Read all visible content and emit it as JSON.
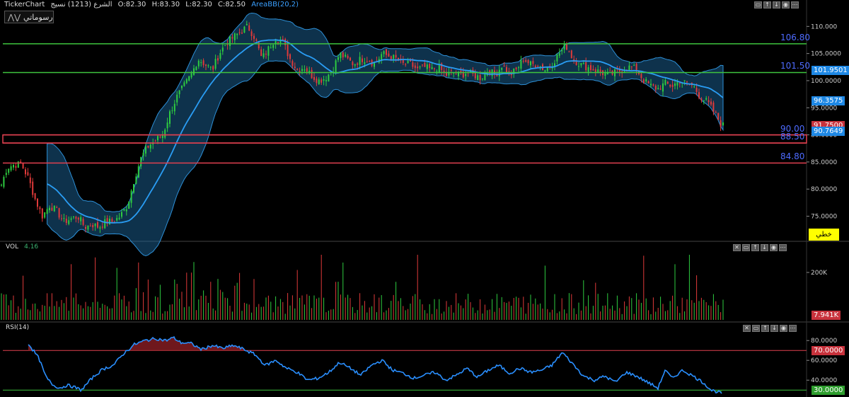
{
  "header": {
    "app": "TickerChart",
    "symbol": "الشرع (1213) نسيج",
    "open": "O:82.30",
    "high": "H:83.30",
    "low": "L:82.30",
    "close": "C:82.50",
    "indicator": "AreaBB(20,2)"
  },
  "toolbar": {
    "drawings_label": "رسوماتي"
  },
  "chart_type_label": "خطي",
  "colors": {
    "up": "#2ecc40",
    "down": "#e03a3a",
    "band": "#1e6ea8",
    "mid": "#2a9df4",
    "green_line": "#3ec43e",
    "red_line": "#e0404f",
    "level_text": "#4d6bff"
  },
  "chart_data": [
    {
      "type": "candlestick",
      "name": "price",
      "yticks": [
        "110.000",
        "105.0000",
        "100.0000",
        "95.0000",
        "80.0000",
        "85.0000",
        "80.0000",
        "75.0000"
      ],
      "ylim": [
        70.5,
        112.0
      ],
      "levels_green": [
        106.8,
        101.5
      ],
      "levels_red": [
        90.0,
        88.5,
        84.8
      ],
      "level_labels": [
        "106.80",
        "101.50",
        "90.00",
        "88.50",
        "84.80"
      ],
      "tags": [
        {
          "text": "101.9501",
          "value": 101.9501,
          "color": "#1e88e5"
        },
        {
          "text": "96.3575",
          "value": 96.3575,
          "color": "#1e88e5"
        },
        {
          "text": "91.7500",
          "value": 91.75,
          "color": "#c8323c"
        },
        {
          "text": "90.7649",
          "value": 90.7649,
          "color": "#1e88e5"
        }
      ],
      "keypoints": [
        [
          0,
          80
        ],
        [
          10,
          84
        ],
        [
          20,
          84.5
        ],
        [
          30,
          84.6
        ],
        [
          40,
          82
        ],
        [
          50,
          78
        ],
        [
          60,
          75
        ],
        [
          70,
          77
        ],
        [
          80,
          76
        ],
        [
          90,
          74
        ],
        [
          100,
          74.5
        ],
        [
          110,
          75
        ],
        [
          120,
          73
        ],
        [
          130,
          73.5
        ],
        [
          140,
          73
        ],
        [
          150,
          74
        ],
        [
          160,
          74
        ],
        [
          170,
          75
        ],
        [
          180,
          77
        ],
        [
          190,
          82
        ],
        [
          200,
          86
        ],
        [
          210,
          88
        ],
        [
          220,
          89
        ],
        [
          230,
          90
        ],
        [
          240,
          94
        ],
        [
          250,
          97
        ],
        [
          260,
          99
        ],
        [
          270,
          101
        ],
        [
          280,
          104
        ],
        [
          290,
          103
        ],
        [
          300,
          102
        ],
        [
          310,
          105
        ],
        [
          320,
          107
        ],
        [
          330,
          108
        ],
        [
          340,
          109
        ],
        [
          350,
          110
        ],
        [
          360,
          108
        ],
        [
          370,
          104
        ],
        [
          380,
          106
        ],
        [
          390,
          108
        ],
        [
          400,
          107
        ],
        [
          410,
          104
        ],
        [
          420,
          102
        ],
        [
          430,
          102.5
        ],
        [
          440,
          101
        ],
        [
          450,
          100
        ],
        [
          460,
          100.5
        ],
        [
          470,
          102
        ],
        [
          480,
          105
        ],
        [
          490,
          104
        ],
        [
          500,
          103
        ],
        [
          510,
          104
        ],
        [
          520,
          104
        ],
        [
          530,
          103
        ],
        [
          540,
          105
        ],
        [
          550,
          104.5
        ],
        [
          560,
          104
        ],
        [
          570,
          103
        ],
        [
          580,
          103
        ],
        [
          590,
          102
        ],
        [
          600,
          102.5
        ],
        [
          610,
          102
        ],
        [
          620,
          102.5
        ],
        [
          630,
          101
        ],
        [
          640,
          101.5
        ],
        [
          650,
          101
        ],
        [
          660,
          101.5
        ],
        [
          670,
          101
        ],
        [
          680,
          100.5
        ],
        [
          690,
          102
        ],
        [
          700,
          101
        ],
        [
          710,
          103
        ],
        [
          720,
          101
        ],
        [
          730,
          102
        ],
        [
          740,
          104
        ],
        [
          750,
          103
        ],
        [
          760,
          103
        ],
        [
          770,
          102
        ],
        [
          780,
          103
        ],
        [
          790,
          105
        ],
        [
          800,
          106.5
        ],
        [
          810,
          104
        ],
        [
          820,
          103
        ],
        [
          830,
          102.5
        ],
        [
          840,
          102
        ],
        [
          850,
          101.5
        ],
        [
          860,
          101
        ],
        [
          870,
          101.5
        ],
        [
          880,
          102
        ],
        [
          890,
          102.5
        ],
        [
          900,
          102
        ],
        [
          910,
          100
        ],
        [
          920,
          99
        ],
        [
          930,
          98.5
        ],
        [
          940,
          99.5
        ],
        [
          950,
          99
        ],
        [
          960,
          100
        ],
        [
          970,
          99.5
        ],
        [
          980,
          99
        ],
        [
          990,
          97
        ],
        [
          1000,
          96
        ],
        [
          1010,
          94
        ],
        [
          1020,
          91.75
        ]
      ]
    },
    {
      "type": "bar",
      "name": "VOL",
      "label": "VOL",
      "last_value": "4.16",
      "yticks": [
        "200K"
      ],
      "tag": "7.941K"
    },
    {
      "type": "line",
      "name": "RSI(14)",
      "label": "RSI(14)",
      "yticks": [
        "80.0000",
        "60.0000",
        "40.0000"
      ],
      "ylim": [
        23,
        88
      ],
      "levels": [
        70,
        30
      ],
      "tags": [
        "70.0000",
        "30.0000"
      ],
      "keypoints": [
        [
          40,
          77
        ],
        [
          55,
          62
        ],
        [
          65,
          43
        ],
        [
          75,
          35
        ],
        [
          85,
          32
        ],
        [
          95,
          35
        ],
        [
          105,
          33
        ],
        [
          115,
          30
        ],
        [
          130,
          42
        ],
        [
          145,
          51
        ],
        [
          160,
          55
        ],
        [
          175,
          67
        ],
        [
          190,
          76
        ],
        [
          205,
          80
        ],
        [
          220,
          82
        ],
        [
          235,
          80
        ],
        [
          245,
          83
        ],
        [
          255,
          78
        ],
        [
          270,
          77
        ],
        [
          285,
          71
        ],
        [
          300,
          75
        ],
        [
          315,
          72
        ],
        [
          330,
          75
        ],
        [
          345,
          71
        ],
        [
          360,
          66
        ],
        [
          375,
          55
        ],
        [
          390,
          60
        ],
        [
          405,
          52
        ],
        [
          420,
          48
        ],
        [
          435,
          40
        ],
        [
          450,
          42
        ],
        [
          465,
          48
        ],
        [
          480,
          58
        ],
        [
          495,
          52
        ],
        [
          510,
          45
        ],
        [
          525,
          55
        ],
        [
          540,
          60
        ],
        [
          555,
          50
        ],
        [
          570,
          47
        ],
        [
          585,
          42
        ],
        [
          600,
          45
        ],
        [
          615,
          48
        ],
        [
          630,
          40
        ],
        [
          645,
          45
        ],
        [
          660,
          52
        ],
        [
          675,
          43
        ],
        [
          690,
          50
        ],
        [
          705,
          55
        ],
        [
          720,
          47
        ],
        [
          735,
          52
        ],
        [
          750,
          48
        ],
        [
          765,
          50
        ],
        [
          780,
          55
        ],
        [
          795,
          68
        ],
        [
          810,
          56
        ],
        [
          825,
          44
        ],
        [
          840,
          40
        ],
        [
          855,
          44
        ],
        [
          870,
          38
        ],
        [
          885,
          48
        ],
        [
          900,
          44
        ],
        [
          915,
          38
        ],
        [
          930,
          32
        ],
        [
          940,
          50
        ],
        [
          950,
          42
        ],
        [
          965,
          50
        ],
        [
          980,
          44
        ],
        [
          995,
          37
        ],
        [
          1005,
          30
        ],
        [
          1020,
          27
        ]
      ]
    }
  ]
}
